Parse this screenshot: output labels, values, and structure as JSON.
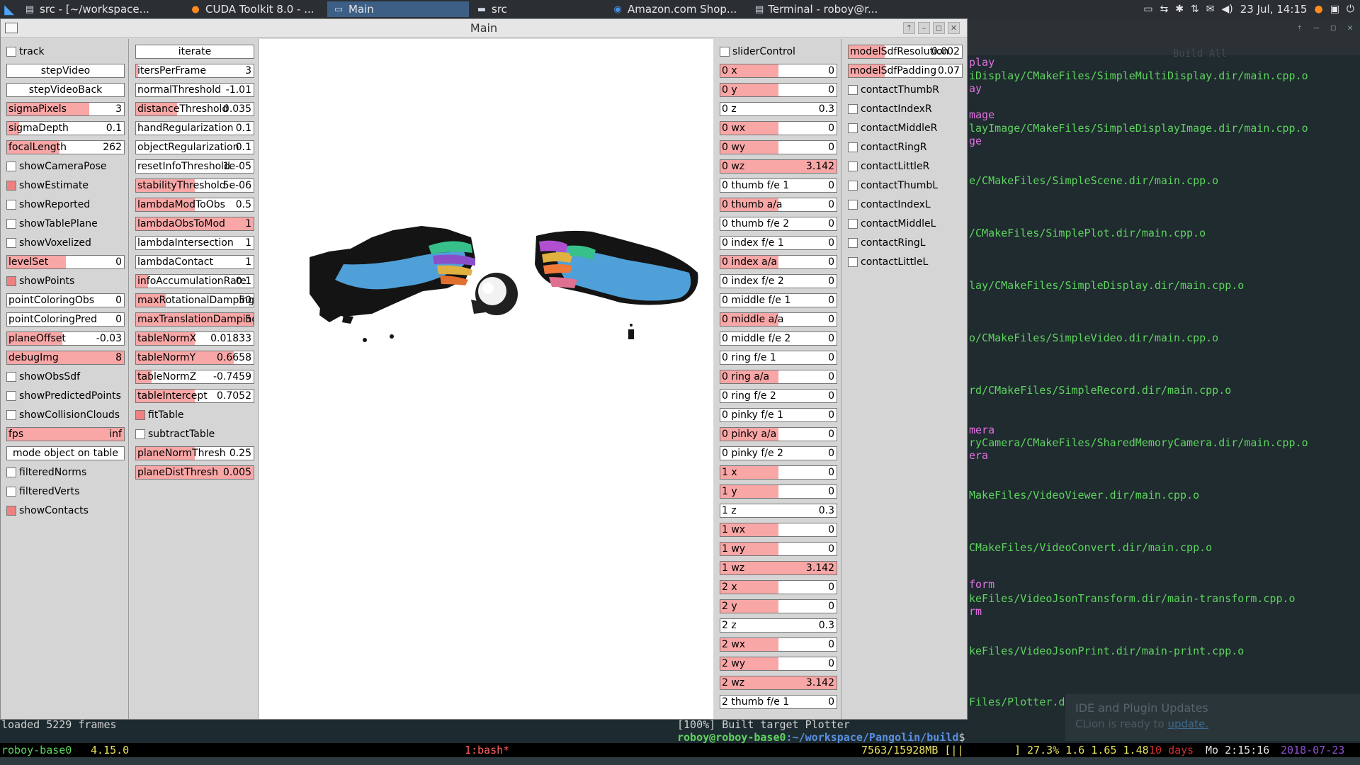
{
  "taskbar": {
    "tasks": [
      {
        "label": "src - [~/workspace...",
        "icon": "terminal-icon"
      },
      {
        "label": "CUDA Toolkit 8.0 - ...",
        "icon": "firefox-icon"
      },
      {
        "label": "Main",
        "icon": "window-icon"
      },
      {
        "label": "src",
        "icon": "folder-icon"
      },
      {
        "label": "Amazon.com Shop...",
        "icon": "chrome-icon"
      },
      {
        "label": "Terminal - roboy@r...",
        "icon": "terminal-icon"
      }
    ],
    "clock": "23 Jul, 14:15"
  },
  "window": {
    "title": "Main"
  },
  "panel1": {
    "items": [
      {
        "type": "check",
        "label": "track",
        "on": false
      },
      {
        "type": "button",
        "label": "stepVideo"
      },
      {
        "type": "button",
        "label": "stepVideoBack"
      },
      {
        "type": "slider",
        "label": "sigmaPixels",
        "value": "3",
        "fill": 0.7
      },
      {
        "type": "slider",
        "label": "sigmaDepth",
        "value": "0.1",
        "fill": 0.1
      },
      {
        "type": "slider",
        "label": "focalLength",
        "value": "262",
        "fill": 0.45
      },
      {
        "type": "check",
        "label": "showCameraPose",
        "on": false
      },
      {
        "type": "check",
        "label": "showEstimate",
        "on": true
      },
      {
        "type": "check",
        "label": "showReported",
        "on": false
      },
      {
        "type": "check",
        "label": "showTablePlane",
        "on": false
      },
      {
        "type": "check",
        "label": "showVoxelized",
        "on": false
      },
      {
        "type": "slider",
        "label": "levelSet",
        "value": "0",
        "fill": 0.5
      },
      {
        "type": "check",
        "label": "showPoints",
        "on": true
      },
      {
        "type": "slider",
        "label": "pointColoringObs",
        "value": "0",
        "fill": 0
      },
      {
        "type": "slider",
        "label": "pointColoringPred",
        "value": "0",
        "fill": 0
      },
      {
        "type": "slider",
        "label": "planeOffset",
        "value": "-0.03",
        "fill": 0.47
      },
      {
        "type": "slider",
        "label": "debugImg",
        "value": "8",
        "fill": 1
      },
      {
        "type": "check",
        "label": "showObsSdf",
        "on": false
      },
      {
        "type": "check",
        "label": "showPredictedPoints",
        "on": false
      },
      {
        "type": "check",
        "label": "showCollisionClouds",
        "on": false
      },
      {
        "type": "slider",
        "label": "fps",
        "value": "inf",
        "fill": 1
      },
      {
        "type": "button",
        "label": "mode object on table"
      },
      {
        "type": "check",
        "label": "filteredNorms",
        "on": false
      },
      {
        "type": "check",
        "label": "filteredVerts",
        "on": false
      },
      {
        "type": "check",
        "label": "showContacts",
        "on": true
      }
    ]
  },
  "panel2": {
    "items": [
      {
        "type": "button",
        "label": "iterate"
      },
      {
        "type": "slider",
        "label": "itersPerFrame",
        "value": "3",
        "fill": 0.02
      },
      {
        "type": "slider",
        "label": "normalThreshold",
        "value": "-1.01",
        "fill": 0
      },
      {
        "type": "slider",
        "label": "distanceThreshold",
        "value": "0.035",
        "fill": 0.35
      },
      {
        "type": "slider",
        "label": "handRegularization",
        "value": "0.1",
        "fill": 0
      },
      {
        "type": "slider",
        "label": "objectRegularization",
        "value": "0.1",
        "fill": 0
      },
      {
        "type": "slider",
        "label": "resetInfoThreshold",
        "value": "1e-05",
        "fill": 0
      },
      {
        "type": "slider",
        "label": "stabilityThreshold",
        "value": "5e-06",
        "fill": 0.5
      },
      {
        "type": "slider",
        "label": "lambdaModToObs",
        "value": "0.5",
        "fill": 0.5
      },
      {
        "type": "slider",
        "label": "lambdaObsToMod",
        "value": "1",
        "fill": 1
      },
      {
        "type": "slider",
        "label": "lambdaIntersection",
        "value": "1",
        "fill": 0
      },
      {
        "type": "slider",
        "label": "lambdaContact",
        "value": "1",
        "fill": 0
      },
      {
        "type": "slider",
        "label": "infoAccumulationRate",
        "value": "0.1",
        "fill": 0.1
      },
      {
        "type": "slider",
        "label": "maxRotationalDamping",
        "value": "50",
        "fill": 0.25
      },
      {
        "type": "slider",
        "label": "maxTranslationDamping",
        "value": "5",
        "fill": 1
      },
      {
        "type": "slider",
        "label": "tableNormX",
        "value": "0.01833",
        "fill": 0.5
      },
      {
        "type": "slider",
        "label": "tableNormY",
        "value": "0.6658",
        "fill": 0.83
      },
      {
        "type": "slider",
        "label": "tableNormZ",
        "value": "-0.7459",
        "fill": 0.13
      },
      {
        "type": "slider",
        "label": "tableIntercept",
        "value": "0.7052",
        "fill": 0.5
      },
      {
        "type": "check",
        "label": "fitTable",
        "on": true
      },
      {
        "type": "check",
        "label": "subtractTable",
        "on": false
      },
      {
        "type": "slider",
        "label": "planeNormThresh",
        "value": "0.25",
        "fill": 0.5
      },
      {
        "type": "slider",
        "label": "planeDistThresh",
        "value": "0.005",
        "fill": 1
      }
    ]
  },
  "panel3": {
    "items": [
      {
        "type": "check",
        "label": "sliderControl",
        "on": false
      },
      {
        "type": "slider",
        "label": "0 x",
        "value": "0",
        "fill": 0.5
      },
      {
        "type": "slider",
        "label": "0 y",
        "value": "0",
        "fill": 0.5
      },
      {
        "type": "slider",
        "label": "0 z",
        "value": "0.3",
        "fill": 0
      },
      {
        "type": "slider",
        "label": "0 wx",
        "value": "0",
        "fill": 0.5
      },
      {
        "type": "slider",
        "label": "0 wy",
        "value": "0",
        "fill": 0.5
      },
      {
        "type": "slider",
        "label": "0 wz",
        "value": "3.142",
        "fill": 1
      },
      {
        "type": "slider",
        "label": "0 thumb f/e 1",
        "value": "0",
        "fill": 0
      },
      {
        "type": "slider",
        "label": "0 thumb a/a",
        "value": "0",
        "fill": 0.5
      },
      {
        "type": "slider",
        "label": "0 thumb f/e 2",
        "value": "0",
        "fill": 0
      },
      {
        "type": "slider",
        "label": "0 index f/e 1",
        "value": "0",
        "fill": 0
      },
      {
        "type": "slider",
        "label": "0 index a/a",
        "value": "0",
        "fill": 0.5
      },
      {
        "type": "slider",
        "label": "0 index f/e 2",
        "value": "0",
        "fill": 0
      },
      {
        "type": "slider",
        "label": "0 middle f/e 1",
        "value": "0",
        "fill": 0
      },
      {
        "type": "slider",
        "label": "0 middle a/a",
        "value": "0",
        "fill": 0.5
      },
      {
        "type": "slider",
        "label": "0 middle f/e 2",
        "value": "0",
        "fill": 0
      },
      {
        "type": "slider",
        "label": "0 ring f/e 1",
        "value": "0",
        "fill": 0
      },
      {
        "type": "slider",
        "label": "0 ring a/a",
        "value": "0",
        "fill": 0.5
      },
      {
        "type": "slider",
        "label": "0 ring f/e 2",
        "value": "0",
        "fill": 0
      },
      {
        "type": "slider",
        "label": "0 pinky f/e 1",
        "value": "0",
        "fill": 0
      },
      {
        "type": "slider",
        "label": "0 pinky a/a",
        "value": "0",
        "fill": 0.5
      },
      {
        "type": "slider",
        "label": "0 pinky f/e 2",
        "value": "0",
        "fill": 0
      },
      {
        "type": "slider",
        "label": "1 x",
        "value": "0",
        "fill": 0.5
      },
      {
        "type": "slider",
        "label": "1 y",
        "value": "0",
        "fill": 0.5
      },
      {
        "type": "slider",
        "label": "1 z",
        "value": "0.3",
        "fill": 0
      },
      {
        "type": "slider",
        "label": "1 wx",
        "value": "0",
        "fill": 0.5
      },
      {
        "type": "slider",
        "label": "1 wy",
        "value": "0",
        "fill": 0.5
      },
      {
        "type": "slider",
        "label": "1 wz",
        "value": "3.142",
        "fill": 1
      },
      {
        "type": "slider",
        "label": "2 x",
        "value": "0",
        "fill": 0.5
      },
      {
        "type": "slider",
        "label": "2 y",
        "value": "0",
        "fill": 0.5
      },
      {
        "type": "slider",
        "label": "2 z",
        "value": "0.3",
        "fill": 0
      },
      {
        "type": "slider",
        "label": "2 wx",
        "value": "0",
        "fill": 0.5
      },
      {
        "type": "slider",
        "label": "2 wy",
        "value": "0",
        "fill": 0.5
      },
      {
        "type": "slider",
        "label": "2 wz",
        "value": "3.142",
        "fill": 1
      },
      {
        "type": "slider",
        "label": "2 thumb f/e 1",
        "value": "0",
        "fill": 0
      }
    ]
  },
  "panel4": {
    "items": [
      {
        "type": "slider",
        "label": "modelSdfResolution",
        "value": "0.002",
        "fill": 0.32
      },
      {
        "type": "slider",
        "label": "modelSdfPadding",
        "value": "0.07",
        "fill": 0.32
      },
      {
        "type": "check",
        "label": "contactThumbR",
        "on": false
      },
      {
        "type": "check",
        "label": "contactIndexR",
        "on": false
      },
      {
        "type": "check",
        "label": "contactMiddleR",
        "on": false
      },
      {
        "type": "check",
        "label": "contactRingR",
        "on": false
      },
      {
        "type": "check",
        "label": "contactLittleR",
        "on": false
      },
      {
        "type": "check",
        "label": "contactThumbL",
        "on": false
      },
      {
        "type": "check",
        "label": "contactIndexL",
        "on": false
      },
      {
        "type": "check",
        "label": "contactMiddleL",
        "on": false
      },
      {
        "type": "check",
        "label": "contactRingL",
        "on": false
      },
      {
        "type": "check",
        "label": "contactLittleL",
        "on": false
      }
    ]
  },
  "ide": {
    "lines": [
      {
        "text": "play",
        "color": "mag"
      },
      {
        "text": "iDisplay/CMakeFiles/SimpleMultiDisplay.dir/main.cpp.o",
        "color": "green"
      },
      {
        "text": "ay",
        "color": "mag"
      },
      {
        "text": "mage",
        "color": "mag"
      },
      {
        "text": "layImage/CMakeFiles/SimpleDisplayImage.dir/main.cpp.o",
        "color": "green"
      },
      {
        "text": "ge",
        "color": "mag"
      },
      {
        "text": "e/CMakeFiles/SimpleScene.dir/main.cpp.o",
        "color": "green"
      },
      {
        "text": "/CMakeFiles/SimplePlot.dir/main.cpp.o",
        "color": "green"
      },
      {
        "text": "lay/CMakeFiles/SimpleDisplay.dir/main.cpp.o",
        "color": "green"
      },
      {
        "text": "o/CMakeFiles/SimpleVideo.dir/main.cpp.o",
        "color": "green"
      },
      {
        "text": "rd/CMakeFiles/SimpleRecord.dir/main.cpp.o",
        "color": "green"
      },
      {
        "text": "mera",
        "color": "mag"
      },
      {
        "text": "ryCamera/CMakeFiles/SharedMemoryCamera.dir/main.cpp.o",
        "color": "green"
      },
      {
        "text": "era",
        "color": "mag"
      },
      {
        "text": "MakeFiles/VideoViewer.dir/main.cpp.o",
        "color": "green"
      },
      {
        "text": "CMakeFiles/VideoConvert.dir/main.cpp.o",
        "color": "green"
      },
      {
        "text": "form",
        "color": "mag"
      },
      {
        "text": "keFiles/VideoJsonTransform.dir/main-transform.cpp.o",
        "color": "green"
      },
      {
        "text": "rm",
        "color": "mag"
      },
      {
        "text": "keFiles/VideoJsonPrint.dir/main-print.cpp.o",
        "color": "green"
      },
      {
        "text": "Files/Plotter.dir/main.cpp.o",
        "color": "green"
      }
    ],
    "build_label": "Build All",
    "popup_title": "IDE and Plugin Updates",
    "popup_text": "CLion is ready to",
    "popup_link": "update."
  },
  "terminal": {
    "loaded": "loaded 5229 frames",
    "built": "[100%] Built target Plotter",
    "prompt_user": "roboy@roboy-base0",
    "prompt_path": ":~/workspace/Pangolin/build",
    "prompt_end": "$"
  },
  "tmux": {
    "host": "roboy-base0",
    "kernel": "4.15.0",
    "window": "1:bash*",
    "mem": "7563/15928MB [||",
    "load": "] 27.3% 1.6 1.65 1.48",
    "days": "10 days",
    "uptime": "Mo 2:15:16",
    "date": "2018-07-23"
  }
}
